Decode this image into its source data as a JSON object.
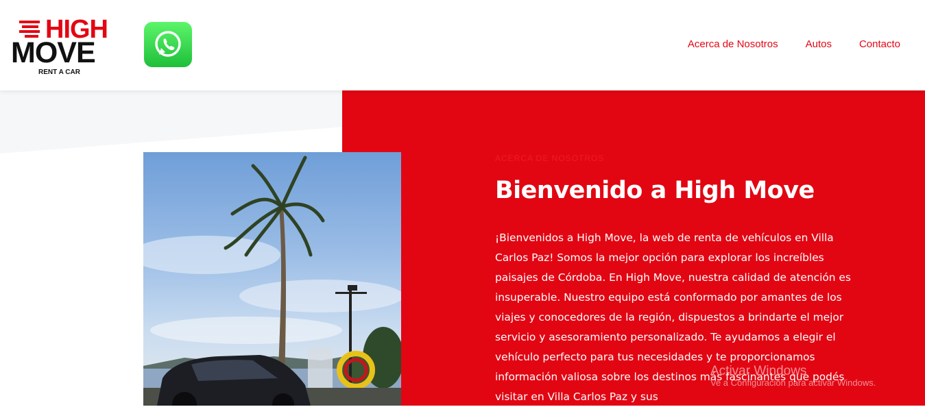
{
  "brand": {
    "logo_top": "HIGH",
    "logo_bottom": "MOVE",
    "logo_sub": "RENT A CAR",
    "accent_color": "#e30613"
  },
  "header": {
    "whatsapp_icon": "whatsapp-icon",
    "nav": [
      {
        "label": "Acerca de Nosotros"
      },
      {
        "label": "Autos"
      },
      {
        "label": "Contacto"
      }
    ]
  },
  "hero": {
    "eyebrow": "ACERCA DE NOSOTROS",
    "title": "Bienvenido a High Move",
    "text": "¡Bienvenidos a High Move, la web de renta de vehículos en Villa Carlos Paz! Somos la mejor opción para explorar los increíbles paisajes de Córdoba. En High Move, nuestra calidad de atención es insuperable. Nuestro equipo está conformado por amantes de los viajes y conocedores de la región, dispuestos a brindarte el mejor servicio y asesoramiento personalizado. Te ayudamos a elegir el vehículo perfecto para tus necesidades y te proporcionamos información valiosa sobre los destinos más fascinantes que podés visitar en Villa Carlos Paz y sus",
    "panel_color": "#e20613"
  },
  "os_watermark": {
    "line1": "Activar Windows",
    "line2": "Ve a Configuración para activar Windows."
  }
}
